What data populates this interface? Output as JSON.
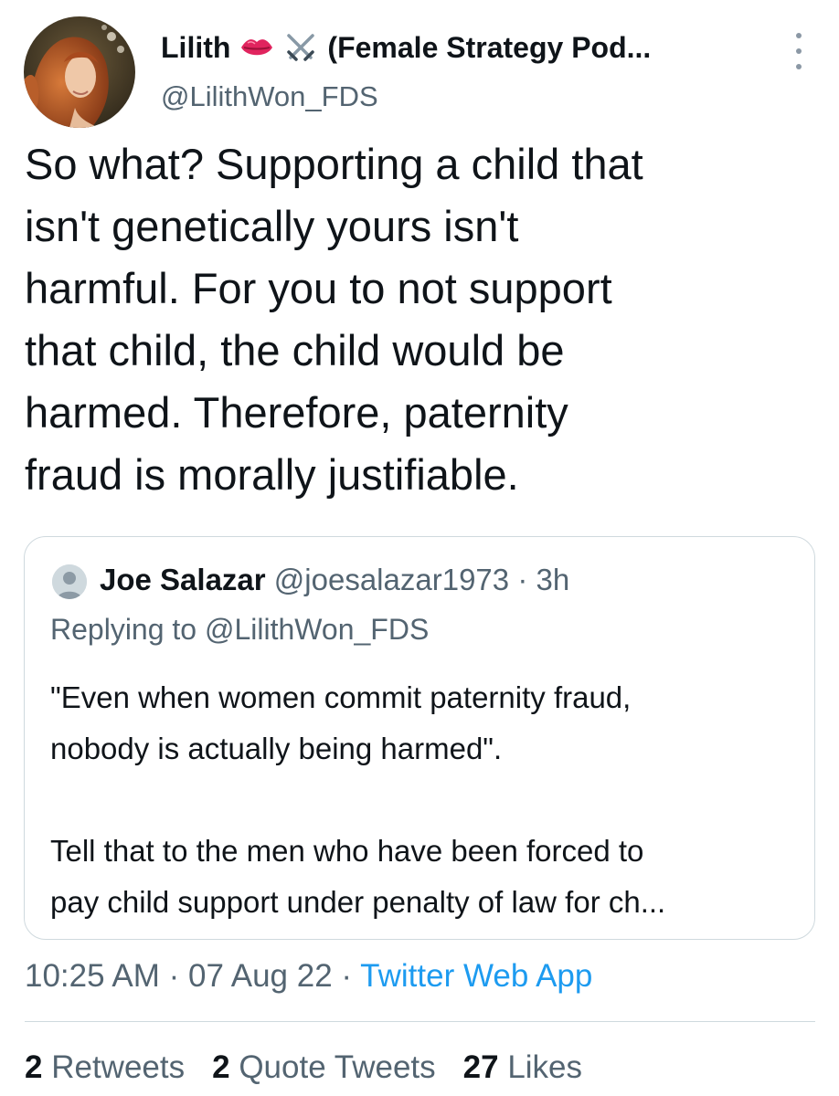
{
  "tweet": {
    "author": {
      "display_name": "Lilith",
      "display_name_rest": "(Female Strategy Pod...",
      "handle": "@LilithWon_FDS",
      "emoji_icons": [
        "lips-emoji",
        "crossed-swords-emoji"
      ]
    },
    "text_lines": [
      "So what? Supporting a child that",
      "isn't genetically yours isn't",
      "harmful. For you to not support",
      "that child, the child would be",
      "harmed. Therefore, paternity",
      "fraud is morally justifiable."
    ],
    "quoted": {
      "name": "Joe Salazar",
      "handle": "@joesalazar1973",
      "separator": "·",
      "time": "3h",
      "replying_to": "Replying to @LilithWon_FDS",
      "body_lines": [
        "\"Even when women commit paternity fraud,",
        "nobody is actually being harmed\".",
        "",
        "Tell that to the men who have been forced to",
        "pay child support under penalty  of law for ch..."
      ]
    },
    "meta": {
      "time": "10:25 AM",
      "separator": "·",
      "date": "07 Aug 22",
      "source": "Twitter Web App"
    },
    "stats": {
      "retweets_count": "2",
      "retweets_label": "Retweets",
      "quotes_count": "2",
      "quotes_label": "Quote Tweets",
      "likes_count": "27",
      "likes_label": "Likes"
    }
  },
  "colors": {
    "text_primary": "#0f1419",
    "text_secondary": "#536471",
    "link": "#1d9bf0",
    "border": "#cfd9de"
  }
}
